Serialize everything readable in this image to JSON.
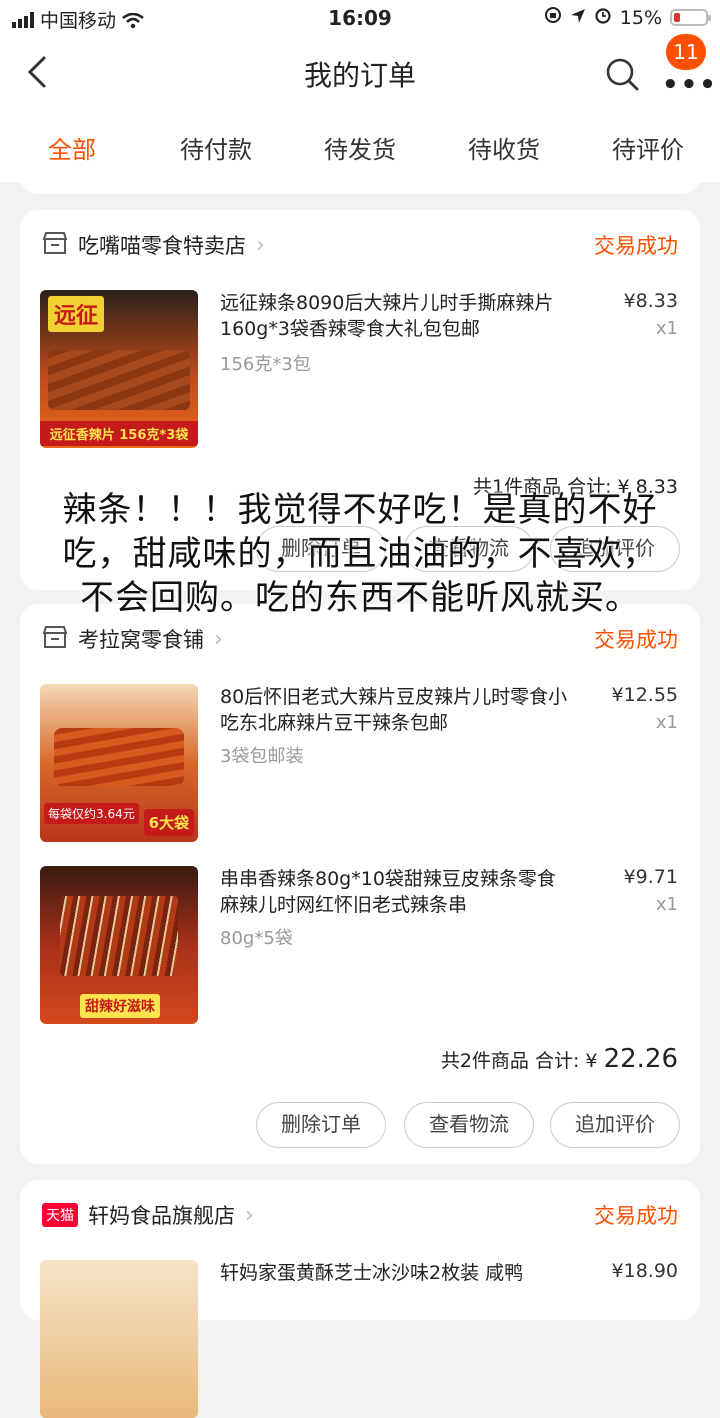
{
  "status_bar": {
    "carrier": "中国移动",
    "time": "16:09",
    "battery": "15%"
  },
  "nav": {
    "title": "我的订单",
    "badge_count": "11"
  },
  "tabs": [
    "全部",
    "待付款",
    "待发货",
    "待收货",
    "待评价"
  ],
  "orders": [
    {
      "store": "吃嘴喵零食特卖店",
      "status": "交易成功",
      "items": [
        {
          "name": "远征辣条8090后大辣片儿时手撕麻辣片160g*3袋香辣零食大礼包包邮",
          "sku": "156克*3包",
          "price": "¥8.33",
          "qty": "x1",
          "img_text_top": "远征",
          "img_text_bottom": "远征香辣片 156克*3袋"
        }
      ],
      "summary": "共1件商品 合计: ¥ 8.33",
      "buttons": [
        "删除订单",
        "查看物流",
        "追加评价"
      ]
    },
    {
      "store": "考拉窝零食铺",
      "status": "交易成功",
      "items": [
        {
          "name": "80后怀旧老式大辣片豆皮辣片儿时零食小吃东北麻辣片豆干辣条包邮",
          "sku": "3袋包邮装",
          "price": "¥12.55",
          "qty": "x1",
          "img_text_bottom": "每袋仅约3.64元",
          "img_badge": "6大袋"
        },
        {
          "name": "串串香辣条80g*10袋甜辣豆皮辣条零食麻辣儿时网红怀旧老式辣条串",
          "sku": "80g*5袋",
          "price": "¥9.71",
          "qty": "x1",
          "img_text_bottom": "甜辣好滋味"
        }
      ],
      "summary_prefix": "共2件商品 合计: ¥",
      "summary_amount": "22.26",
      "buttons": [
        "删除订单",
        "查看物流",
        "追加评价"
      ]
    },
    {
      "store": "轩妈食品旗舰店",
      "store_tag": "天猫",
      "status": "交易成功",
      "items": [
        {
          "name": "轩妈家蛋黄酥芝士冰沙味2枚装 咸鸭",
          "price": "¥18.90"
        }
      ]
    }
  ],
  "overlay_text": [
    "辣条！！！我觉得不好吃！是真的不好",
    "吃，甜咸味的，而且油油的，不喜欢，",
    "不会回购。吃的东西不能听风就买。"
  ],
  "colors": {
    "accent": "#ff5000",
    "background": "#f2f2f2"
  }
}
